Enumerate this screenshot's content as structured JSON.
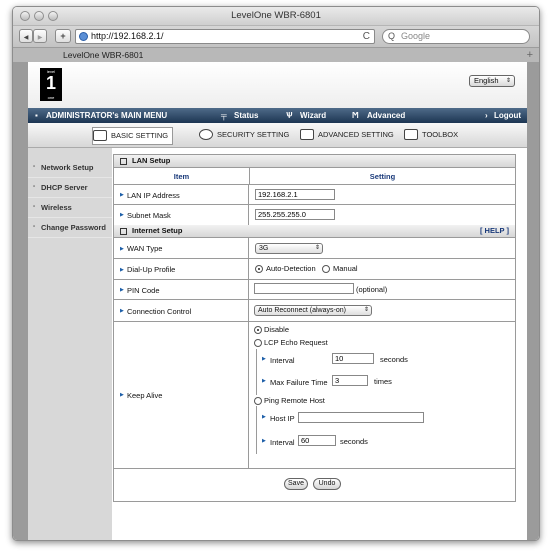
{
  "browser": {
    "window_title": "LevelOne WBR-6801",
    "url": "http://192.168.2.1/",
    "search_placeholder": "Google",
    "tab_title": "LevelOne WBR-6801",
    "back": "◀",
    "forward": "▶",
    "add": "+",
    "reload": "C",
    "tab_add": "+"
  },
  "header": {
    "logo_top": "level",
    "logo_mark": "1",
    "logo_bottom": "one",
    "language": "English"
  },
  "menu": {
    "title": "ADMINISTRATOR's MAIN MENU",
    "status": "Status",
    "wizard": "Wizard",
    "advanced": "Advanced",
    "logout": "Logout"
  },
  "subtabs": {
    "basic": "BASIC SETTING",
    "security": "SECURITY SETTING",
    "advanced": "ADVANCED SETTING",
    "toolbox": "TOOLBOX"
  },
  "sidebar": {
    "items": [
      {
        "label": "Network Setup"
      },
      {
        "label": "DHCP Server"
      },
      {
        "label": "Wireless"
      },
      {
        "label": "Change Password"
      }
    ]
  },
  "lan": {
    "section": "LAN Setup",
    "col_item": "Item",
    "col_setting": "Setting",
    "ip_label": "LAN IP Address",
    "ip_value": "192.168.2.1",
    "mask_label": "Subnet Mask",
    "mask_value": "255.255.255.0"
  },
  "internet": {
    "section": "Internet Setup",
    "help": "[ HELP ]",
    "wan_label": "WAN Type",
    "wan_value": "3G",
    "dialup_label": "Dial-Up Profile",
    "dialup_auto": "Auto-Detection",
    "dialup_manual": "Manual",
    "pin_label": "PIN Code",
    "pin_value": "",
    "pin_hint": "(optional)",
    "conn_label": "Connection Control",
    "conn_value": "Auto Reconnect (always-on)",
    "keepalive_label": "Keep Alive",
    "disable": "Disable",
    "lcp": "LCP Echo Request",
    "interval_label": "Interval",
    "interval_value": "10",
    "seconds": "seconds",
    "maxfail_label": "Max Failure Time",
    "maxfail_value": "3",
    "times": "times",
    "ping": "Ping Remote Host",
    "hostip_label": "Host IP",
    "hostip_value": "",
    "interval2_label": "Interval",
    "interval2_value": "60",
    "seconds2": "seconds"
  },
  "buttons": {
    "save": "Save",
    "undo": "Undo"
  }
}
